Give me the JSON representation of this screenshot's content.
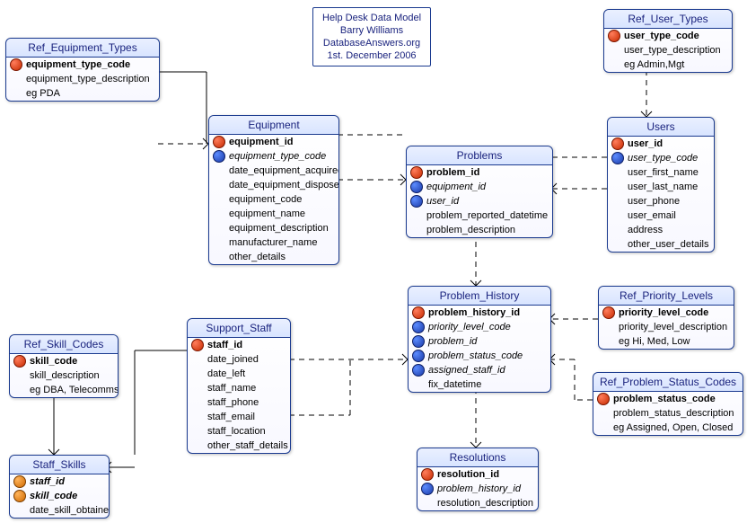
{
  "info": {
    "line1": "Help Desk Data Model",
    "line2": "Barry Williams",
    "line3": "DatabaseAnswers.org",
    "line4": "1st. December 2006"
  },
  "entities": {
    "ref_equipment_types": {
      "title": "Ref_Equipment_Types",
      "attrs": [
        {
          "key": "pk",
          "name": "equipment_type_code"
        },
        {
          "key": "",
          "name": "equipment_type_description"
        },
        {
          "key": "",
          "name": "eg PDA"
        }
      ]
    },
    "equipment": {
      "title": "Equipment",
      "attrs": [
        {
          "key": "pk",
          "name": "equipment_id"
        },
        {
          "key": "fk",
          "name": "equipment_type_code"
        },
        {
          "key": "",
          "name": "date_equipment_acquired"
        },
        {
          "key": "",
          "name": "date_equipment_disposed"
        },
        {
          "key": "",
          "name": "equipment_code"
        },
        {
          "key": "",
          "name": "equipment_name"
        },
        {
          "key": "",
          "name": "equipment_description"
        },
        {
          "key": "",
          "name": "manufacturer_name"
        },
        {
          "key": "",
          "name": "other_details"
        }
      ]
    },
    "problems": {
      "title": "Problems",
      "attrs": [
        {
          "key": "pk",
          "name": "problem_id"
        },
        {
          "key": "fk",
          "name": "equipment_id"
        },
        {
          "key": "fk",
          "name": "user_id"
        },
        {
          "key": "",
          "name": "problem_reported_datetime"
        },
        {
          "key": "",
          "name": "problem_description"
        }
      ]
    },
    "ref_user_types": {
      "title": "Ref_User_Types",
      "attrs": [
        {
          "key": "pk",
          "name": "user_type_code"
        },
        {
          "key": "",
          "name": "user_type_description"
        },
        {
          "key": "",
          "name": "eg Admin,Mgt"
        }
      ]
    },
    "users": {
      "title": "Users",
      "attrs": [
        {
          "key": "pk",
          "name": "user_id"
        },
        {
          "key": "fk",
          "name": "user_type_code"
        },
        {
          "key": "",
          "name": "user_first_name"
        },
        {
          "key": "",
          "name": "user_last_name"
        },
        {
          "key": "",
          "name": "user_phone"
        },
        {
          "key": "",
          "name": "user_email"
        },
        {
          "key": "",
          "name": "address"
        },
        {
          "key": "",
          "name": "other_user_details"
        }
      ]
    },
    "problem_history": {
      "title": "Problem_History",
      "attrs": [
        {
          "key": "pk",
          "name": "problem_history_id"
        },
        {
          "key": "fk",
          "name": "priority_level_code"
        },
        {
          "key": "fk",
          "name": "problem_id"
        },
        {
          "key": "fk",
          "name": "problem_status_code"
        },
        {
          "key": "fk",
          "name": "assigned_staff_id"
        },
        {
          "key": "",
          "name": "fix_datetime"
        }
      ]
    },
    "ref_priority_levels": {
      "title": "Ref_Priority_Levels",
      "attrs": [
        {
          "key": "pk",
          "name": "priority_level_code"
        },
        {
          "key": "",
          "name": "priority_level_description"
        },
        {
          "key": "",
          "name": "eg Hi, Med, Low"
        }
      ]
    },
    "ref_problem_status_codes": {
      "title": "Ref_Problem_Status_Codes",
      "attrs": [
        {
          "key": "pk",
          "name": "problem_status_code"
        },
        {
          "key": "",
          "name": "problem_status_description"
        },
        {
          "key": "",
          "name": "eg Assigned, Open, Closed"
        }
      ]
    },
    "support_staff": {
      "title": "Support_Staff",
      "attrs": [
        {
          "key": "pk",
          "name": "staff_id"
        },
        {
          "key": "",
          "name": "date_joined"
        },
        {
          "key": "",
          "name": "date_left"
        },
        {
          "key": "",
          "name": "staff_name"
        },
        {
          "key": "",
          "name": "staff_phone"
        },
        {
          "key": "",
          "name": "staff_email"
        },
        {
          "key": "",
          "name": "staff_location"
        },
        {
          "key": "",
          "name": "other_staff_details"
        }
      ]
    },
    "ref_skill_codes": {
      "title": "Ref_Skill_Codes",
      "attrs": [
        {
          "key": "pk",
          "name": "skill_code"
        },
        {
          "key": "",
          "name": "skill_description"
        },
        {
          "key": "",
          "name": "eg DBA, Telecomms"
        }
      ]
    },
    "staff_skills": {
      "title": "Staff_Skills",
      "attrs": [
        {
          "key": "pf",
          "name": "staff_id"
        },
        {
          "key": "pf",
          "name": "skill_code"
        },
        {
          "key": "",
          "name": "date_skill_obtained"
        }
      ]
    },
    "resolutions": {
      "title": "Resolutions",
      "attrs": [
        {
          "key": "pk",
          "name": "resolution_id"
        },
        {
          "key": "fk",
          "name": "problem_history_id"
        },
        {
          "key": "",
          "name": "resolution_description"
        }
      ]
    }
  }
}
